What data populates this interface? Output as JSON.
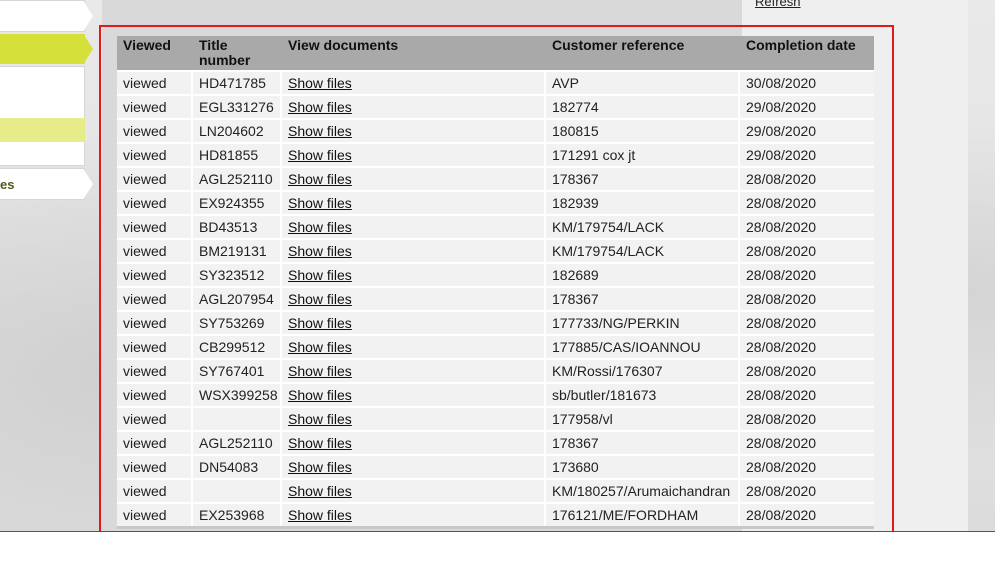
{
  "nav": {
    "item_partial_label": "es"
  },
  "header_link": {
    "refresh": "Refresh"
  },
  "table": {
    "headers": {
      "viewed": "Viewed",
      "title_number": "Title number",
      "view_documents": "View documents",
      "customer_reference": "Customer reference",
      "completion_date": "Completion date"
    },
    "rows": [
      {
        "viewed": "viewed",
        "title": "HD471785",
        "docs": "Show files",
        "ref": "AVP",
        "date": "30/08/2020"
      },
      {
        "viewed": "viewed",
        "title": "EGL331276",
        "docs": "Show files",
        "ref": "182774",
        "date": "29/08/2020"
      },
      {
        "viewed": "viewed",
        "title": "LN204602",
        "docs": "Show files",
        "ref": "180815",
        "date": "29/08/2020"
      },
      {
        "viewed": "viewed",
        "title": "HD81855",
        "docs": "Show files",
        "ref": "171291 cox jt",
        "date": "29/08/2020"
      },
      {
        "viewed": "viewed",
        "title": "AGL252110",
        "docs": "Show files",
        "ref": "178367",
        "date": "28/08/2020"
      },
      {
        "viewed": "viewed",
        "title": "EX924355",
        "docs": "Show files",
        "ref": "182939",
        "date": "28/08/2020"
      },
      {
        "viewed": "viewed",
        "title": "BD43513",
        "docs": "Show files",
        "ref": "KM/179754/LACK",
        "date": "28/08/2020"
      },
      {
        "viewed": "viewed",
        "title": "BM219131",
        "docs": "Show files",
        "ref": "KM/179754/LACK",
        "date": "28/08/2020"
      },
      {
        "viewed": "viewed",
        "title": "SY323512",
        "docs": "Show files",
        "ref": "182689",
        "date": "28/08/2020"
      },
      {
        "viewed": "viewed",
        "title": "AGL207954",
        "docs": "Show files",
        "ref": "178367",
        "date": "28/08/2020"
      },
      {
        "viewed": "viewed",
        "title": "SY753269",
        "docs": "Show files",
        "ref": "177733/NG/PERKIN",
        "date": "28/08/2020"
      },
      {
        "viewed": "viewed",
        "title": "CB299512",
        "docs": "Show files",
        "ref": "177885/CAS/IOANNOU",
        "date": "28/08/2020"
      },
      {
        "viewed": "viewed",
        "title": "SY767401",
        "docs": "Show files",
        "ref": "KM/Rossi/176307",
        "date": "28/08/2020"
      },
      {
        "viewed": "viewed",
        "title": "WSX399258",
        "docs": "Show files",
        "ref": "sb/butler/181673",
        "date": "28/08/2020"
      },
      {
        "viewed": "viewed",
        "title": "",
        "docs": "Show files",
        "ref": "177958/vl",
        "date": "28/08/2020"
      },
      {
        "viewed": "viewed",
        "title": "AGL252110",
        "docs": "Show files",
        "ref": "178367",
        "date": "28/08/2020"
      },
      {
        "viewed": "viewed",
        "title": "DN54083",
        "docs": "Show files",
        "ref": "173680",
        "date": "28/08/2020"
      },
      {
        "viewed": "viewed",
        "title": "",
        "docs": "Show files",
        "ref": "KM/180257/Arumaichandran",
        "date": "28/08/2020"
      },
      {
        "viewed": "viewed",
        "title": "EX253968",
        "docs": "Show files",
        "ref": "176121/ME/FORDHAM",
        "date": "28/08/2020"
      }
    ]
  },
  "colors": {
    "nav_active": "#d5e03a",
    "nav_subactive": "#e6ec8a",
    "header_bg": "#a9a9a9",
    "highlight_border": "#e01919"
  }
}
